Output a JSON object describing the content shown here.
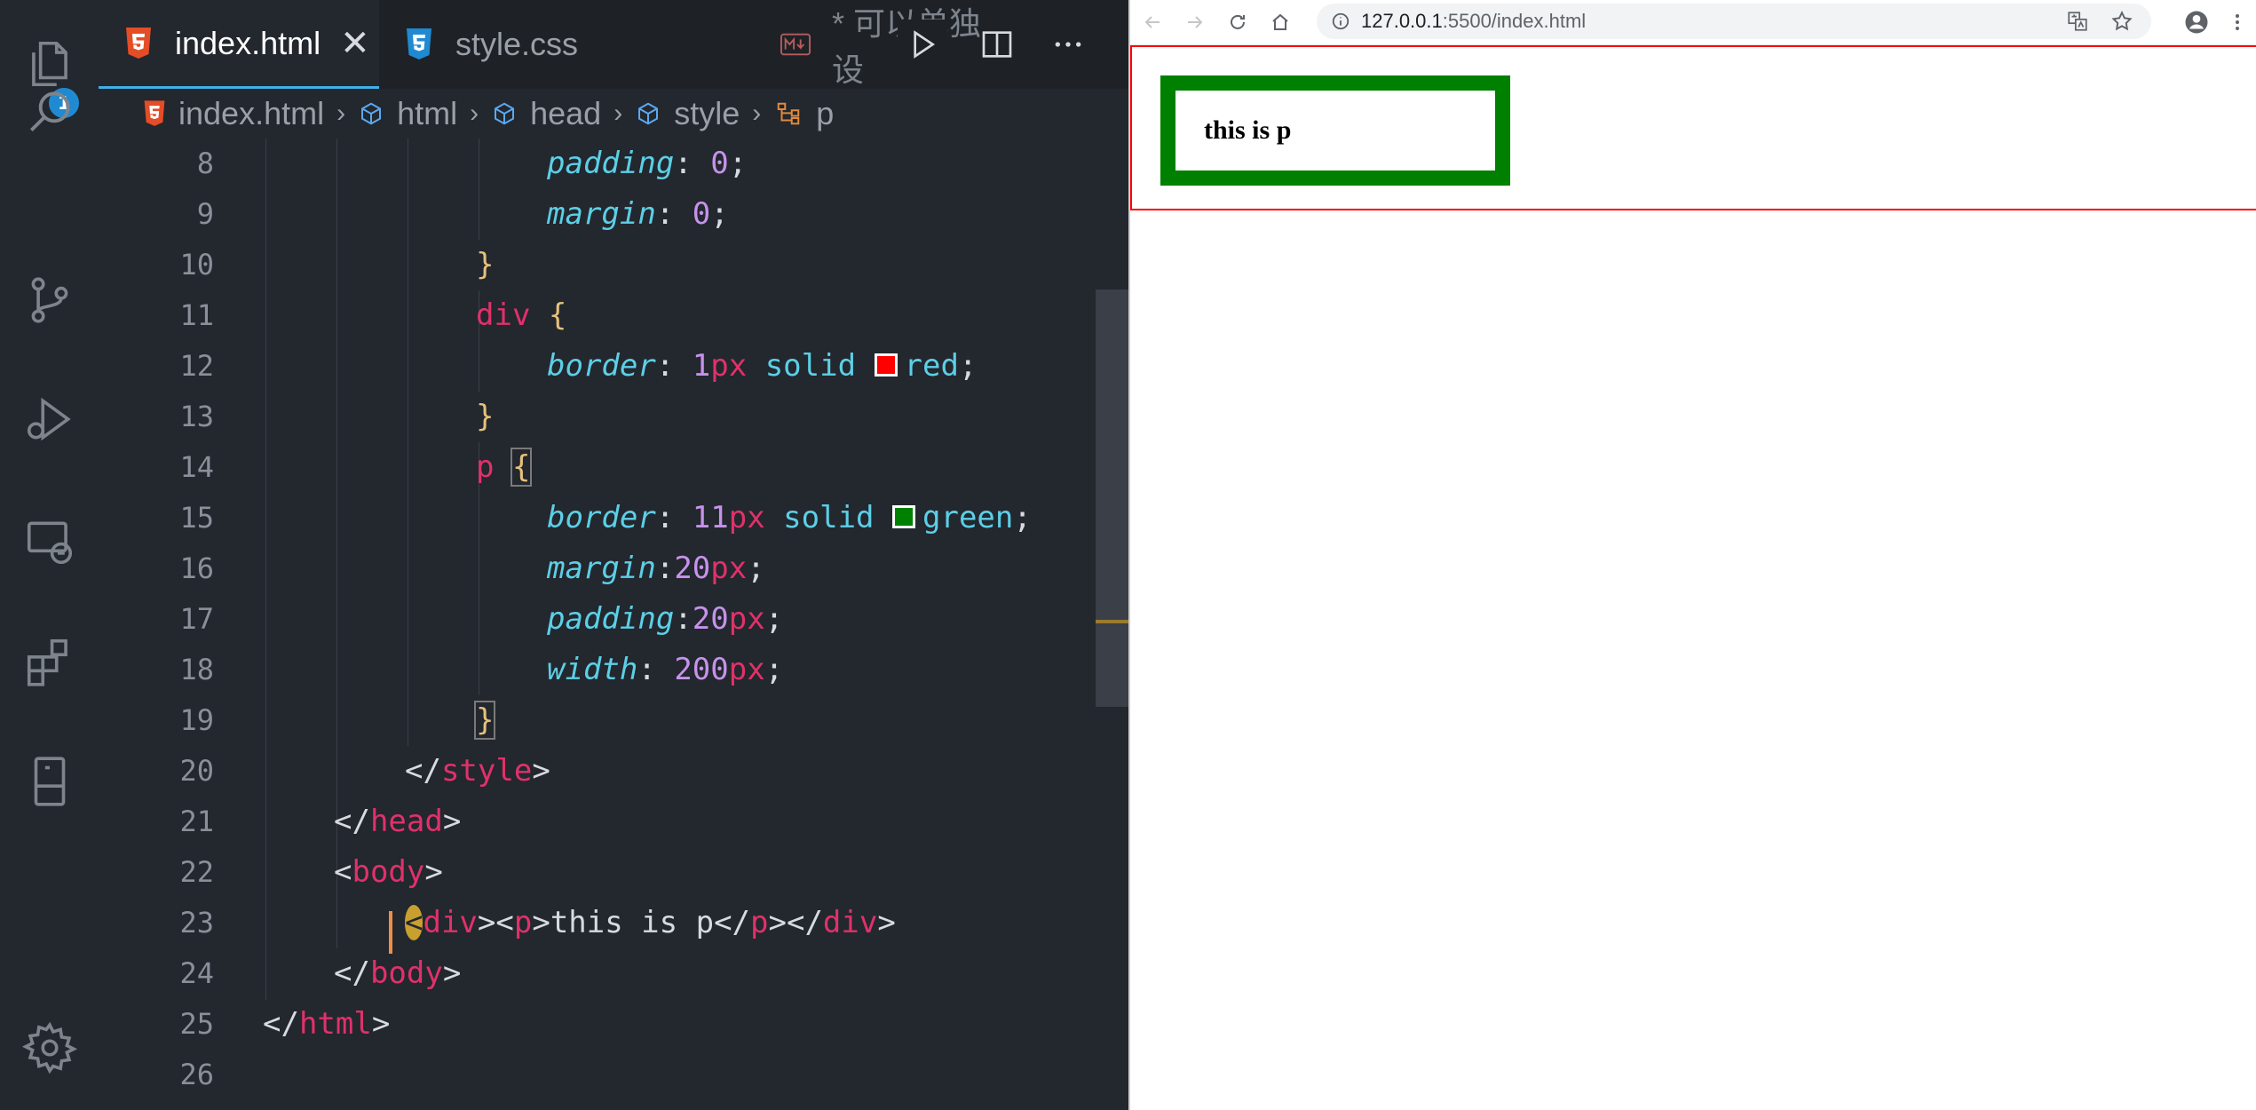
{
  "tabs": [
    {
      "label": "index.html",
      "close": "✕"
    },
    {
      "label": "style.css"
    },
    {
      "label": "* 可以单独设"
    }
  ],
  "activity": {
    "explorer_badge": "1"
  },
  "breadcrumb": [
    "index.html",
    "html",
    "head",
    "style",
    "p"
  ],
  "line_numbers": [
    "8",
    "9",
    "10",
    "11",
    "12",
    "13",
    "14",
    "15",
    "16",
    "17",
    "18",
    "19",
    "20",
    "21",
    "22",
    "23",
    "24",
    "25",
    "26"
  ],
  "code": {
    "l8": {
      "prop": "padding",
      "num": "0"
    },
    "l9": {
      "prop": "margin",
      "num": "0"
    },
    "l10": {
      "brace": "}"
    },
    "l11": {
      "sel": "div",
      "brace": "{"
    },
    "l12": {
      "prop": "border",
      "num": "1",
      "unit": "px",
      "kw": "solid",
      "color": "red",
      "color_hex": "#ff0000"
    },
    "l13": {
      "brace": "}"
    },
    "l14": {
      "sel": "p",
      "brace": "{"
    },
    "l15": {
      "prop": "border",
      "num": "11",
      "unit": "px",
      "kw": "solid",
      "color": "green",
      "color_hex": "#008000"
    },
    "l16": {
      "prop": "margin",
      "num": "20",
      "unit": "px"
    },
    "l17": {
      "prop": "padding",
      "num": "20",
      "unit": "px"
    },
    "l18": {
      "prop": "width",
      "num": "200",
      "unit": "px"
    },
    "l19": {
      "brace": "}"
    },
    "l20": {
      "tag": "style"
    },
    "l21": {
      "tag": "head"
    },
    "l22": {
      "tag": "body"
    },
    "l23": {
      "outer": "div",
      "inner": "p",
      "text": "this is p"
    },
    "l24": {
      "tag": "body"
    },
    "l25": {
      "tag": "html"
    }
  },
  "browser": {
    "url_host": "127.0.0.1",
    "url_rest": ":5500/index.html",
    "content_text": "this  is  p"
  },
  "colors": {
    "editor_bg": "#23272e",
    "accent": "#3fb0e8",
    "tag": "#e0316a",
    "property": "#5ccfe6",
    "number": "#c792ea"
  }
}
